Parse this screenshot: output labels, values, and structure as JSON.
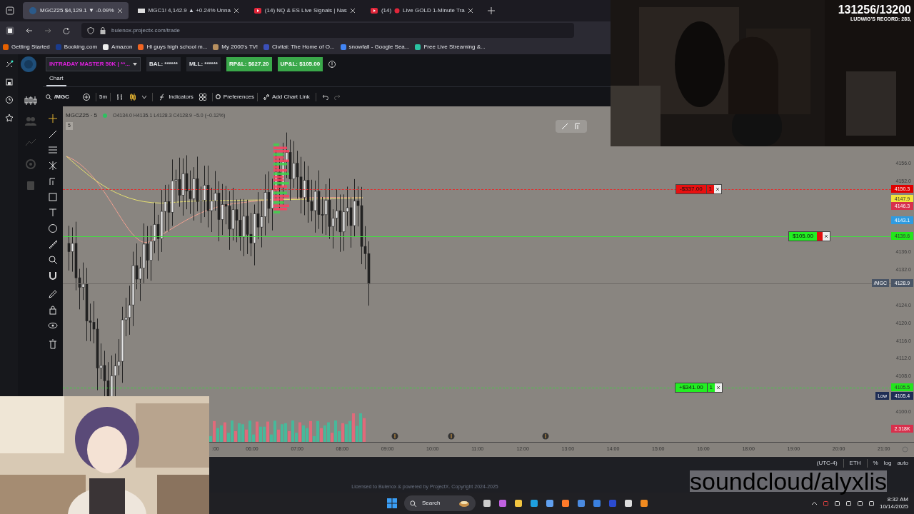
{
  "browser": {
    "tabs": [
      {
        "label": "MGCZ25 $4,129.1 ▼ -0.09%",
        "selected": true
      },
      {
        "label": "MGC1! 4,142.9 ▲ +0.24% Unna",
        "selected": false
      },
      {
        "label": "(14) NQ & ES Live Signals | Nas",
        "selected": false
      },
      {
        "label": "(14)",
        "label_rest": "Live GOLD 1-Minute Tra",
        "selected": false
      }
    ],
    "address": "bulenox.projectx.com/trade",
    "bookmarks": [
      "Getting Started",
      "Booking.com",
      "Amazon",
      "Hi guys high school m...",
      "My 2000's TV!",
      "Civitai: The Home of O...",
      "snowfall - Google Sea...",
      "Free Live Streaming &..."
    ]
  },
  "app_header": {
    "account": "INTRADAY MASTER 50K | **...",
    "balance": "BAL: ******",
    "mll": "MLL: ******",
    "rpl": "RP&L: $627.20",
    "upl": "UP&L: $105.00"
  },
  "chart_tab": "Chart",
  "toolbar": {
    "symbol": "/MGC",
    "interval": "5m",
    "indicators": "Indicators",
    "preferences": "Preferences",
    "add_chart_link": "Add Chart Link"
  },
  "chart": {
    "title": "MGCZ25 · 5",
    "ohlc": "O4134.0 H4135.1 L4128.3 C4128.9 −5.0 (−0.12%)",
    "interval_badge": "5",
    "y_axis": [
      "4156.0",
      "4152.0",
      "4136.0",
      "4132.0",
      "4124.0",
      "4120.0",
      "4116.0",
      "4112.0",
      "4108.0",
      "4100.0"
    ],
    "x_axis": [
      ":00",
      "06:00",
      "07:00",
      "08:00",
      "09:00",
      "10:00",
      "11:00",
      "12:00",
      "13:00",
      "14:00",
      "15:00",
      "16:00",
      "18:00",
      "19:00",
      "20:00",
      "21:00"
    ],
    "price_tags": [
      {
        "kind": "stop",
        "text": "4150.3",
        "color": "#e00000"
      },
      {
        "kind": "average",
        "text": "4147.9",
        "color": "#f2e53a"
      },
      {
        "kind": "ask",
        "text": "4146.3",
        "color": "#d8304c"
      },
      {
        "kind": "bid",
        "text": "4143.1",
        "color": "#2f9be0"
      },
      {
        "kind": "entry",
        "text": "4139.6",
        "color": "#22e61c"
      },
      {
        "kind": "last",
        "label": "/MGC",
        "text": "4128.9",
        "color": "#4a5566"
      },
      {
        "kind": "target",
        "text": "4105.5",
        "color": "#22e61c"
      },
      {
        "kind": "low",
        "label": "Low",
        "text": "4105.4",
        "color": "#1f2d55"
      },
      {
        "kind": "volume",
        "text": "2.318K",
        "color": "#d8304c"
      }
    ],
    "orders": [
      {
        "kind": "stop",
        "pnl": "-$337.00",
        "qty": "1"
      },
      {
        "kind": "position",
        "pnl": "$105.00"
      },
      {
        "kind": "target",
        "pnl": "+$341.00",
        "qty": "1"
      }
    ]
  },
  "status_bar": {
    "timezone": "(UTC-4)",
    "session": "ETH",
    "percent": "%",
    "log": "log",
    "auto": "auto"
  },
  "license": "Licensed to Bulenox & powered by ProjectX. Copyright 2024-2025",
  "taskbar": {
    "search": "Search",
    "time": "8:32 AM",
    "date": "10/14/2025"
  },
  "stream_overlay": {
    "counter": "131256/13200",
    "record": "LUDWIG'S RECORD: 283,",
    "soundcloud": "soundcloud/alyxlis"
  }
}
